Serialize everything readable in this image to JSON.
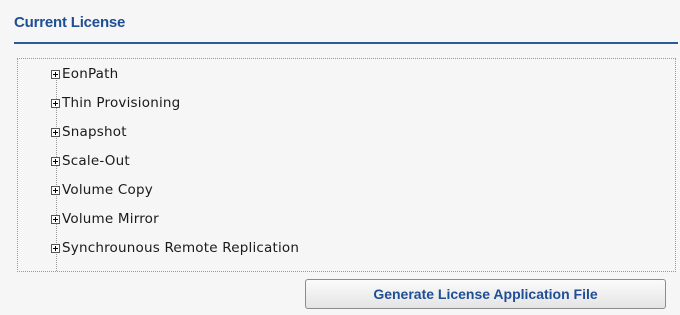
{
  "section": {
    "title": "Current License"
  },
  "tree": {
    "items": [
      {
        "label": "EonPath"
      },
      {
        "label": "Thin Provisioning"
      },
      {
        "label": "Snapshot"
      },
      {
        "label": "Scale-Out"
      },
      {
        "label": "Volume Copy"
      },
      {
        "label": "Volume Mirror"
      },
      {
        "label": "Synchrounous Remote Replication"
      }
    ],
    "expander_icon": "plus-expander-icon"
  },
  "actions": {
    "generate_label": "Generate License Application File"
  },
  "colors": {
    "accent": "#1f4e95",
    "header_rule": "#2d5a9a",
    "background": "#f6f6f6"
  }
}
